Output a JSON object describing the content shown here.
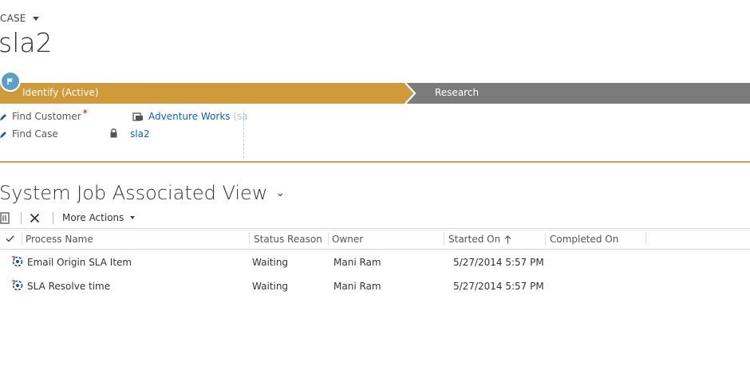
{
  "header": {
    "entity_type": "CASE",
    "record_title": "sla2"
  },
  "process": {
    "stages": [
      {
        "label": "Identify (Active)"
      },
      {
        "label": "Research"
      }
    ],
    "colors": {
      "active": "#cf9a3a",
      "inactive": "#7b7b7b",
      "flag": "#5a9fc8"
    }
  },
  "fields": [
    {
      "label": "Find Customer",
      "required": "*",
      "value": "Adventure Works",
      "value_faded": "(sa"
    },
    {
      "label": "Find Case",
      "value": "sla2"
    }
  ],
  "view": {
    "title": "System Job Associated View",
    "more_actions": "More Actions",
    "columns": [
      "Process Name",
      "Status Reason",
      "Owner",
      "Started On",
      "Completed On"
    ],
    "rows": [
      {
        "process_name": "Email Origin SLA Item",
        "status_reason": "Waiting",
        "owner": "Mani Ram",
        "started_on": "5/27/2014 5:57 PM",
        "completed_on": ""
      },
      {
        "process_name": "SLA Resolve time",
        "status_reason": "Waiting",
        "owner": "Mani Ram",
        "started_on": "5/27/2014 5:57 PM",
        "completed_on": ""
      }
    ]
  }
}
